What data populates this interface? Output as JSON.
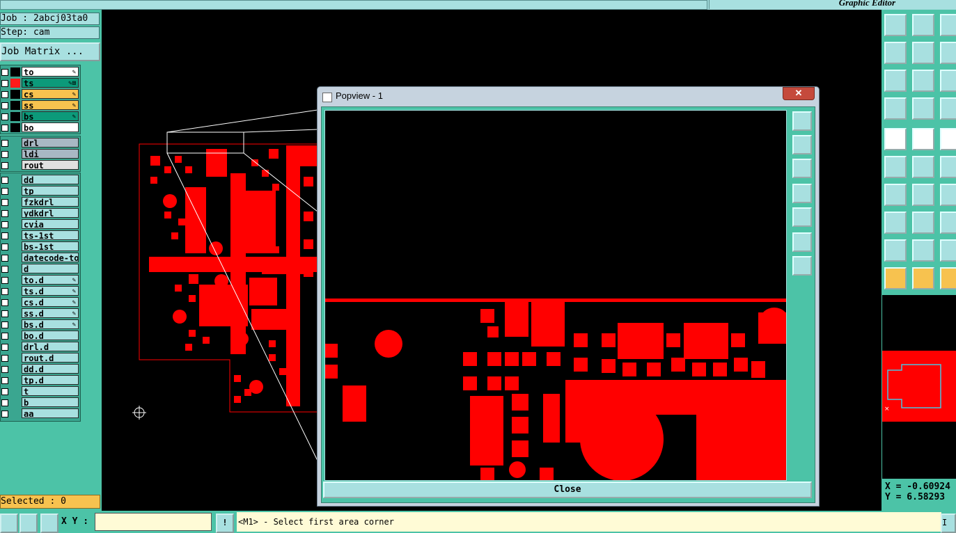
{
  "topbar": {
    "title": "Graphic Editor"
  },
  "leftpanel": {
    "job": "Job : 2abcj03ta0",
    "step": "Step: cam",
    "job_matrix": "Job Matrix ...",
    "board_layers": [
      {
        "name": "to",
        "color": "#ffffff",
        "marker": "#000000",
        "icon": "✎"
      },
      {
        "name": "ts",
        "color": "#0c9a7a",
        "marker": "#ff1a1a",
        "icon": "✎⊞"
      },
      {
        "name": "cs",
        "color": "#f7c24f",
        "marker": "#000000",
        "icon": "✎"
      },
      {
        "name": "ss",
        "color": "#f7c24f",
        "marker": "#000000",
        "icon": "✎"
      },
      {
        "name": "bs",
        "color": "#0c9a7a",
        "marker": "#000000",
        "icon": "✎"
      },
      {
        "name": "bo",
        "color": "#ffffff",
        "marker": "#000000",
        "icon": ""
      }
    ],
    "drill_layers": [
      {
        "name": "drl",
        "color": "#a8b8c4"
      },
      {
        "name": "ldi",
        "color": "#a8b8c4"
      },
      {
        "name": "rout",
        "color": "#e0e0e0"
      }
    ],
    "misc_layers": [
      {
        "name": "dd",
        "icon": ""
      },
      {
        "name": "tp",
        "icon": ""
      },
      {
        "name": "fzkdrl",
        "icon": ""
      },
      {
        "name": "ydkdrl",
        "icon": ""
      },
      {
        "name": "cvia",
        "icon": ""
      },
      {
        "name": "ts-1st",
        "icon": ""
      },
      {
        "name": "bs-1st",
        "icon": ""
      },
      {
        "name": "datecode-to",
        "icon": ""
      },
      {
        "name": "d",
        "icon": ""
      },
      {
        "name": "to.d",
        "icon": "✎"
      },
      {
        "name": "ts.d",
        "icon": "✎"
      },
      {
        "name": "cs.d",
        "icon": "✎"
      },
      {
        "name": "ss.d",
        "icon": "✎"
      },
      {
        "name": "bs.d",
        "icon": "✎"
      },
      {
        "name": "bo.d",
        "icon": ""
      },
      {
        "name": "drl.d",
        "icon": ""
      },
      {
        "name": "rout.d",
        "icon": ""
      },
      {
        "name": "dd.d",
        "icon": ""
      },
      {
        "name": "tp.d",
        "icon": ""
      },
      {
        "name": "t",
        "icon": ""
      },
      {
        "name": "b",
        "icon": ""
      },
      {
        "name": "aa",
        "icon": ""
      }
    ],
    "selected": "Selected : 0"
  },
  "popview": {
    "title": "Popview - 1",
    "close_icon": "✕",
    "close_label": "Close"
  },
  "bottombar": {
    "xy_label": "X Y :",
    "xy_value": "",
    "alert_icon": "!",
    "message": "<M1> - Select first area corner",
    "right_label": "I"
  },
  "coords": {
    "x": "X = -0.60924",
    "y": "Y = 6.58293"
  },
  "colors": {
    "accent": "#4cc3a7",
    "pcb_red": "#ff0000",
    "button": "#a8e0e0"
  }
}
